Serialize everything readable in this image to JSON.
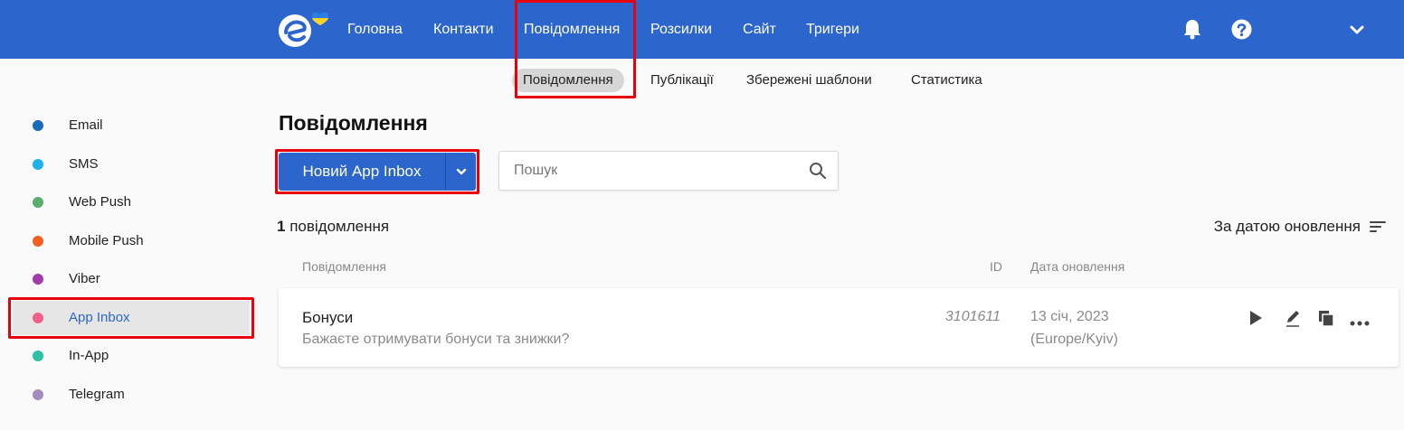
{
  "colors": {
    "brand": "#2c66cc",
    "highlight": "#e8000b"
  },
  "topnav": {
    "items": [
      "Головна",
      "Контакти",
      "Повідомлення",
      "Розсилки",
      "Сайт",
      "Тригери"
    ],
    "icons": [
      "bell-icon",
      "help-icon",
      "chevron-down-icon"
    ]
  },
  "subnav": {
    "items": [
      "Повідомлення",
      "Публікації",
      "Збережені шаблони",
      "Статистика"
    ],
    "active": 0
  },
  "sidebar": {
    "items": [
      {
        "label": "Email",
        "color": "#1a6bb8"
      },
      {
        "label": "SMS",
        "color": "#1eb2e8"
      },
      {
        "label": "Web Push",
        "color": "#5bac6e"
      },
      {
        "label": "Mobile Push",
        "color": "#f06022"
      },
      {
        "label": "Viber",
        "color": "#a23da8"
      },
      {
        "label": "App Inbox",
        "color": "#f0628e"
      },
      {
        "label": "In-App",
        "color": "#2fbfa3"
      },
      {
        "label": "Telegram",
        "color": "#a48cc0"
      }
    ],
    "active": 5
  },
  "main": {
    "title": "Повідомлення",
    "new_button_label": "Новий App Inbox",
    "search_placeholder": "Пошук",
    "count_number": "1",
    "count_label": "повідомлення",
    "sort_label": "За датою оновлення",
    "columns": {
      "message": "Повідомлення",
      "id": "ID",
      "date": "Дата оновлення"
    },
    "rows": [
      {
        "name": "Бонуси",
        "description": "Бажаєте отримувати бонуси та знижки?",
        "id": "3101611",
        "date": "13 січ, 2023",
        "timezone": "(Europe/Kyiv)"
      }
    ]
  }
}
